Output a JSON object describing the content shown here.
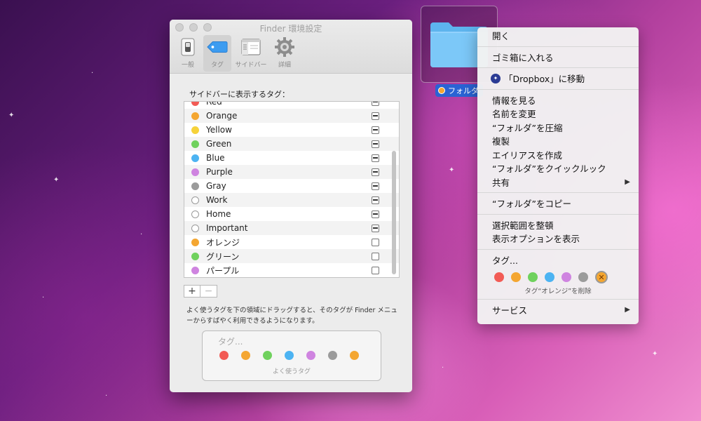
{
  "window": {
    "title": "Finder 環境設定",
    "toolbar": [
      {
        "label": "一般",
        "icon": "switch-icon"
      },
      {
        "label": "タグ",
        "icon": "tag-icon"
      },
      {
        "label": "サイドバー",
        "icon": "sidebar-icon"
      },
      {
        "label": "詳細",
        "icon": "gear-icon"
      }
    ],
    "section_label": "サイドバーに表示するタグ：",
    "tags": [
      {
        "label": "Red",
        "color": "#f25b55",
        "checked": true
      },
      {
        "label": "Orange",
        "color": "#f4a631",
        "checked": true
      },
      {
        "label": "Yellow",
        "color": "#f6d23a",
        "checked": true
      },
      {
        "label": "Green",
        "color": "#6fd15d",
        "checked": true
      },
      {
        "label": "Blue",
        "color": "#4cb3f2",
        "checked": true
      },
      {
        "label": "Purple",
        "color": "#cf84e0",
        "checked": true
      },
      {
        "label": "Gray",
        "color": "#9b9b9b",
        "checked": true
      },
      {
        "label": "Work",
        "color": "",
        "checked": true
      },
      {
        "label": "Home",
        "color": "",
        "checked": true
      },
      {
        "label": "Important",
        "color": "",
        "checked": true
      },
      {
        "label": "オレンジ",
        "color": "#f4a631",
        "checked": false
      },
      {
        "label": "グリーン",
        "color": "#6fd15d",
        "checked": false
      },
      {
        "label": "パープル",
        "color": "#cf84e0",
        "checked": false
      }
    ],
    "add_label": "+",
    "remove_label": "−",
    "help_text": "よく使うタグを下の領域にドラッグすると、そのタグが Finder メニューからすばやく利用できるようになります。",
    "favorites": {
      "placeholder": "タグ...",
      "caption": "よく使うタグ",
      "colors": [
        "#f25b55",
        "#f4a631",
        "#6fd15d",
        "#4cb3f2",
        "#cf84e0",
        "#9b9b9b",
        "#f4a631"
      ]
    }
  },
  "desktop": {
    "folder_name": "フォルダ",
    "folder_tag_color": "#f4a631"
  },
  "context_menu": {
    "groups": [
      [
        {
          "label": "開く"
        }
      ],
      [
        {
          "label": "ゴミ箱に入れる"
        }
      ],
      [
        {
          "label": "「Dropbox」に移動",
          "icon": "dropbox-icon"
        }
      ],
      [
        {
          "label": "情報を見る"
        },
        {
          "label": "名前を変更"
        },
        {
          "label": "“フォルダ”を圧縮"
        },
        {
          "label": "複製"
        },
        {
          "label": "エイリアスを作成"
        },
        {
          "label": "“フォルダ”をクイックルック"
        },
        {
          "label": "共有",
          "submenu": true
        }
      ],
      [
        {
          "label": "“フォルダ”をコピー"
        }
      ],
      [
        {
          "label": "選択範囲を整頓"
        },
        {
          "label": "表示オプションを表示"
        }
      ]
    ],
    "tags_label": "タグ...",
    "tag_colors": [
      "#f25b55",
      "#f4a631",
      "#6fd15d",
      "#4cb3f2",
      "#cf84e0",
      "#9b9b9b",
      "#f4a631"
    ],
    "selected_tag_index": 6,
    "remove_tag_caption": "タグ“オレンジ”を削除",
    "services_label": "サービス",
    "submenu_arrow": "▶"
  }
}
